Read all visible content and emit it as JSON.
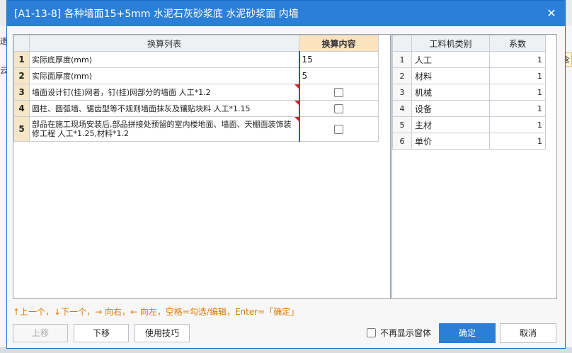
{
  "title": "[A1-13-8] 各种墙面15+5mm 水泥石灰砂浆底 水泥砂浆面 内墙",
  "background": {
    "right_fragment": "不含",
    "left_fragment_1": "遗",
    "left_fragment_2": "云"
  },
  "conversion_table": {
    "headers": {
      "list": "换算列表",
      "content": "换算内容"
    },
    "rows": [
      {
        "num": "1",
        "name": "实际底厚度(mm)",
        "value": "15"
      },
      {
        "num": "2",
        "name": "实际面厚度(mm)",
        "value": "5"
      },
      {
        "num": "3",
        "name": "墙面设计钉(挂)网者，钉(挂)网部分的墙面 人工*1.2",
        "checked": false
      },
      {
        "num": "4",
        "name": "圆柱、圆弧墙、锯齿型等不规则墙面抹灰及镶贴块料 人工*1.15",
        "checked": false
      },
      {
        "num": "5",
        "name": "部品在施工现场安装后,部品拼接处预留的室内楼地面、墙面、天棚面装饰装修工程 人工*1.25,材料*1.2",
        "checked": false
      }
    ]
  },
  "factor_table": {
    "headers": {
      "type": "工料机类别",
      "factor": "系数"
    },
    "rows": [
      {
        "num": "1",
        "type": "人工",
        "factor": "1"
      },
      {
        "num": "2",
        "type": "材料",
        "factor": "1"
      },
      {
        "num": "3",
        "type": "机械",
        "factor": "1"
      },
      {
        "num": "4",
        "type": "设备",
        "factor": "1"
      },
      {
        "num": "5",
        "type": "主材",
        "factor": "1"
      },
      {
        "num": "6",
        "type": "单价",
        "factor": "1"
      }
    ]
  },
  "hint": "↑上一个，↓下一个，→ 向右，← 向左，空格=勾选/编辑，Enter=「确定」",
  "buttons": {
    "prev": "上移",
    "next": "下移",
    "tips": "使用技巧",
    "ok": "确定",
    "cancel": "取消"
  },
  "no_show_label": "不再显示窗体",
  "colors": {
    "titlebar": "#2b7fd6",
    "accent_header": "#fbe3c0",
    "hint": "#e07800"
  }
}
